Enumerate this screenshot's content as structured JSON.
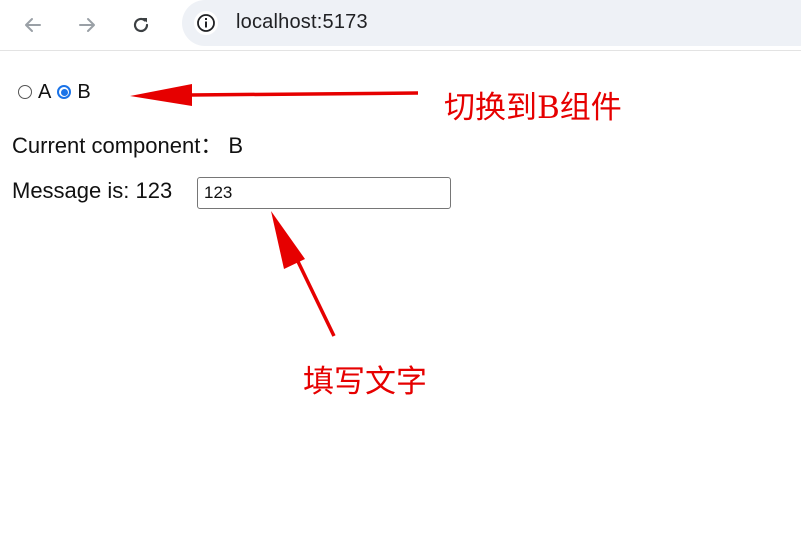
{
  "browser": {
    "url": "localhost:5173",
    "icons": {
      "back": "arrow-left-icon",
      "forward": "arrow-right-icon",
      "reload": "reload-icon",
      "info": "info-icon"
    }
  },
  "radios": [
    {
      "label": "A",
      "checked": false
    },
    {
      "label": "B",
      "checked": true
    }
  ],
  "current_component": "Current component： B",
  "message": {
    "label": "Message is: 123",
    "input_value": "123"
  },
  "annotations": {
    "switch_to_b": "切换到B组件",
    "fill_text": "填写文字",
    "color": "#e60000"
  },
  "colors": {
    "accent": "#1a73e8",
    "address_bar": "#eef1f6"
  }
}
